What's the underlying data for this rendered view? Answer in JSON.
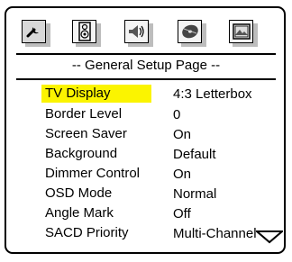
{
  "header": {
    "title": "-- General Setup Page --",
    "tabs": [
      {
        "name": "General Setup",
        "icon": "wrench-icon",
        "active": true
      },
      {
        "name": "Audio Setup",
        "icon": "speaker-icon",
        "active": false
      },
      {
        "name": "Dolby Digital Setup",
        "icon": "speaker-waves-icon",
        "active": false
      },
      {
        "name": "Preference",
        "icon": "disc-icon",
        "active": false
      },
      {
        "name": "Video Setup",
        "icon": "picture-icon",
        "active": false
      }
    ]
  },
  "settings": [
    {
      "label": "TV Display",
      "value": "4:3 Letterbox",
      "selected": true
    },
    {
      "label": "Border Level",
      "value": "0",
      "selected": false
    },
    {
      "label": "Screen Saver",
      "value": "On",
      "selected": false
    },
    {
      "label": "Background",
      "value": "Default",
      "selected": false
    },
    {
      "label": "Dimmer Control",
      "value": "On",
      "selected": false
    },
    {
      "label": "OSD Mode",
      "value": "Normal",
      "selected": false
    },
    {
      "label": "Angle Mark",
      "value": "Off",
      "selected": false
    },
    {
      "label": "SACD Priority",
      "value": "Multi-Channel",
      "selected": false
    }
  ],
  "colors": {
    "highlight": "#fbf400",
    "frame": "#000000",
    "tab_active_bg": "#d8d8d8"
  },
  "scroll_indicator": "down-triangle-icon"
}
